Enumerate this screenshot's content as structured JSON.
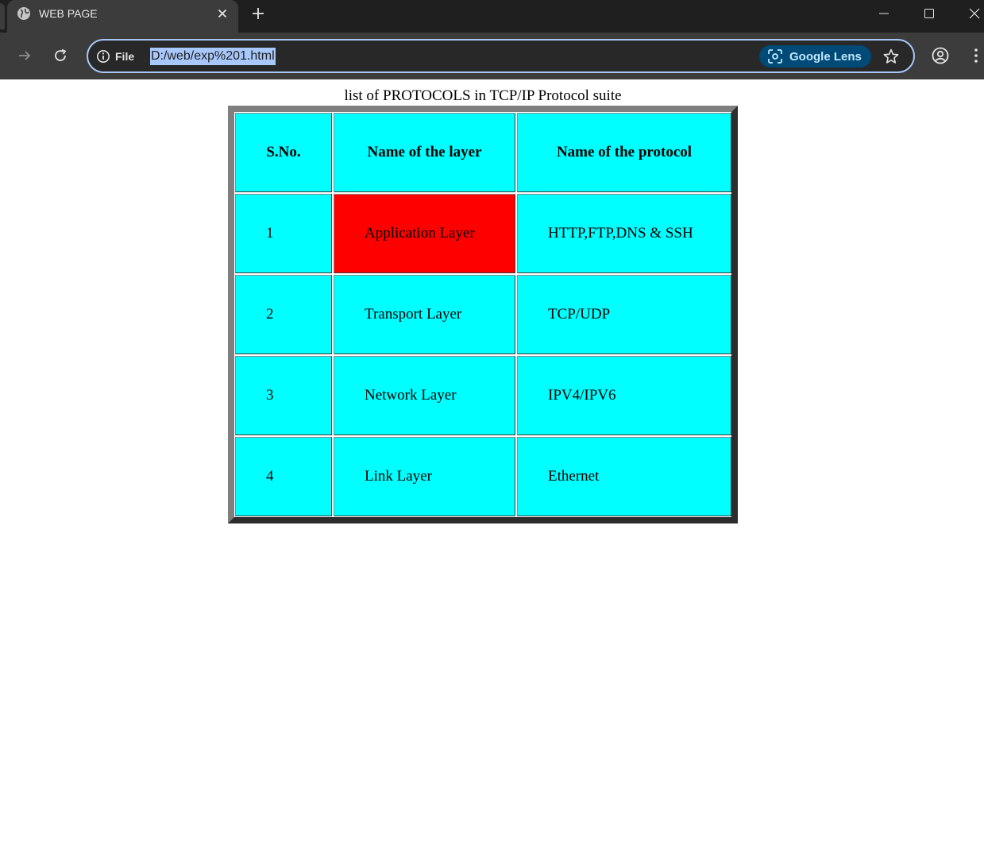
{
  "browser": {
    "tab_title": "WEB PAGE",
    "site_info_label": "File",
    "url": "D:/web/exp%201.html",
    "lens_label": "Google Lens"
  },
  "page": {
    "caption": "list of PROTOCOLS in TCP/IP Protocol suite",
    "table": {
      "headers": [
        "S.No.",
        "Name of the layer",
        "Name of the protocol"
      ],
      "rows": [
        [
          "1",
          "Application Layer",
          "HTTP,FTP,DNS & SSH"
        ],
        [
          "2",
          "Transport Layer",
          "TCP/UDP"
        ],
        [
          "3",
          "Network Layer",
          "IPV4/IPV6"
        ],
        [
          "4",
          "Link Layer",
          "Ethernet"
        ]
      ],
      "highlighted_cell": {
        "row": 0,
        "col": 1,
        "color": "#ff0000"
      },
      "cell_color": "#00ffff"
    }
  }
}
